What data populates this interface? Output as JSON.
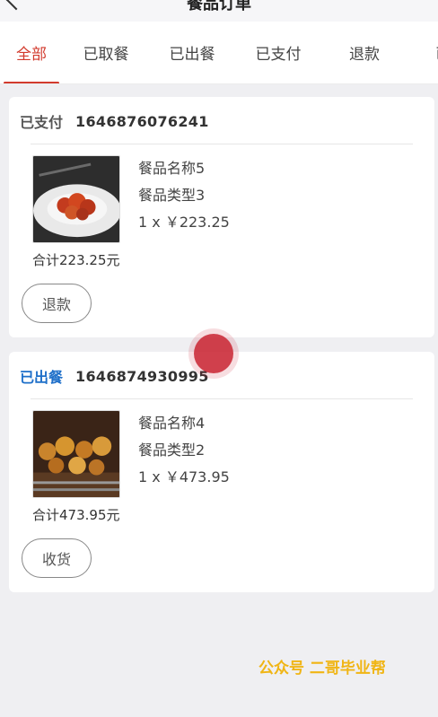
{
  "header": {
    "title": "餐品订单"
  },
  "tabs": [
    {
      "label": "全部",
      "active": true
    },
    {
      "label": "已取餐",
      "active": false
    },
    {
      "label": "已出餐",
      "active": false
    },
    {
      "label": "已支付",
      "active": false
    },
    {
      "label": "退款",
      "active": false
    },
    {
      "label": "已评",
      "active": false
    }
  ],
  "orders": [
    {
      "status": "已支付",
      "order_no": "1646876076241",
      "item_name": "餐品名称5",
      "item_type": "餐品类型3",
      "qty_price": "1 x ￥223.25",
      "total": "合计223.25元",
      "action": "退款",
      "status_color": "#555555"
    },
    {
      "status": "已出餐",
      "order_no": "1646874930995",
      "item_name": "餐品名称4",
      "item_type": "餐品类型2",
      "qty_price": "1 x ￥473.95",
      "total": "合计473.95元",
      "action": "收货",
      "status_color": "#1e6fc9"
    }
  ],
  "watermark": "公众号 二哥毕业帮"
}
